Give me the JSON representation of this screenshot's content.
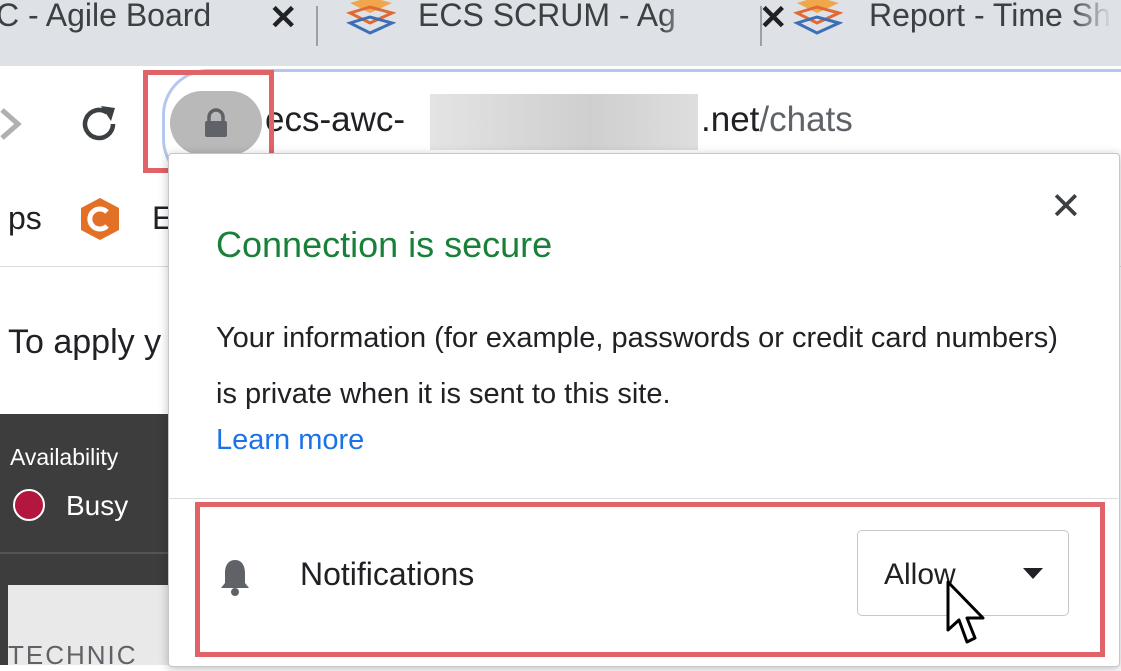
{
  "tabs": [
    {
      "title": "C - Agile Board",
      "close": "✕"
    },
    {
      "title": "ECS SCRUM - Ag",
      "close": "✕"
    },
    {
      "title": "Report - Time Sh",
      "close": ""
    }
  ],
  "toolbar": {
    "url_prefix": "ecs-awc-",
    "url_domain": ".net",
    "url_path": "/chats"
  },
  "bookmarks": {
    "partial_label": "ps",
    "item_partial": "E"
  },
  "page": {
    "partial_text": "To apply y",
    "availability_label": "Availability",
    "status_label": "Busy",
    "status_color": "#b3163f",
    "section_partial": "TECHNIC"
  },
  "popup": {
    "close_glyph": "✕",
    "title": "Connection is secure",
    "description": "Your information (for example, passwords or credit card numbers) is private when it is sent to this site.",
    "learn_more": "Learn more",
    "permission_label": "Notifications",
    "permission_value": "Allow"
  },
  "colors": {
    "secure_green": "#188038",
    "link_blue": "#1a73e8",
    "highlight_red": "#e06367"
  },
  "icons": [
    "lock-icon",
    "reload-icon",
    "back-icon",
    "bell-icon",
    "site-favicon",
    "bookmark-favicon",
    "cursor-arrow"
  ]
}
